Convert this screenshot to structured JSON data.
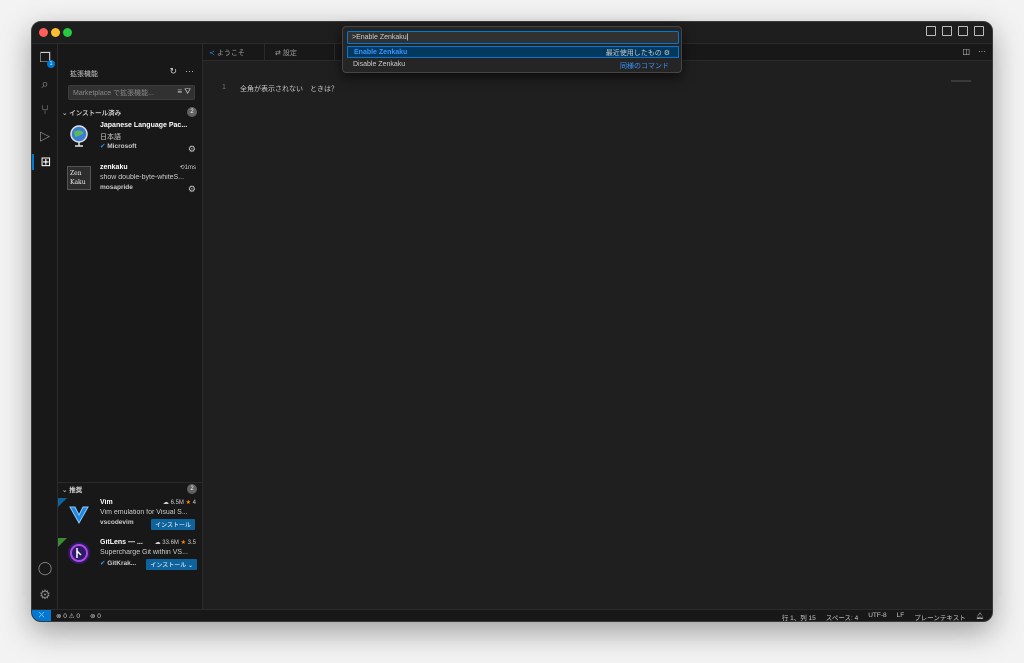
{
  "sidebar": {
    "title": "拡張機能",
    "search_placeholder": "Marketplace で拡張機能...",
    "installed_header": "インストール済み",
    "installed_count": "2",
    "installed": [
      {
        "name": "Japanese Language Pac...",
        "desc": "日本語",
        "publisher": "Microsoft"
      },
      {
        "name": "zenkaku",
        "desc": "show double-byte-whiteS...",
        "publisher": "mosapride",
        "time": "1ms"
      }
    ],
    "recommended_header": "推奨",
    "recommended_count": "2",
    "recommended": [
      {
        "name": "Vim",
        "desc": "Vim emulation for Visual S...",
        "publisher": "vscodevim",
        "downloads": "6.5M",
        "rating": "4",
        "install_label": "インストール"
      },
      {
        "name": "GitLens — ...",
        "desc": "Supercharge Git within VS...",
        "publisher": "GitKrak...",
        "downloads": "33.6M",
        "rating": "3.5",
        "install_label": "インストール"
      }
    ]
  },
  "tabs": [
    {
      "label": "ようこそ"
    },
    {
      "label": "設定"
    }
  ],
  "editor": {
    "line_number": "1",
    "line_text": "全角が表示されない　ときは？"
  },
  "palette": {
    "input_value": ">Enable Zenkaku",
    "items": [
      {
        "label": "Enable Zenkaku",
        "meta": "最近使用したもの"
      },
      {
        "label": "Disable Zenkaku",
        "meta": "同様のコマンド"
      }
    ]
  },
  "status": {
    "errors": "0",
    "warnings": "0",
    "ports": "0",
    "position": "行 1、列 15",
    "spaces": "スペース: 4",
    "encoding": "UTF-8",
    "eol": "LF",
    "language": "プレーンテキスト"
  },
  "colors": {
    "accent": "#0078d4",
    "install": "#0e639c"
  }
}
